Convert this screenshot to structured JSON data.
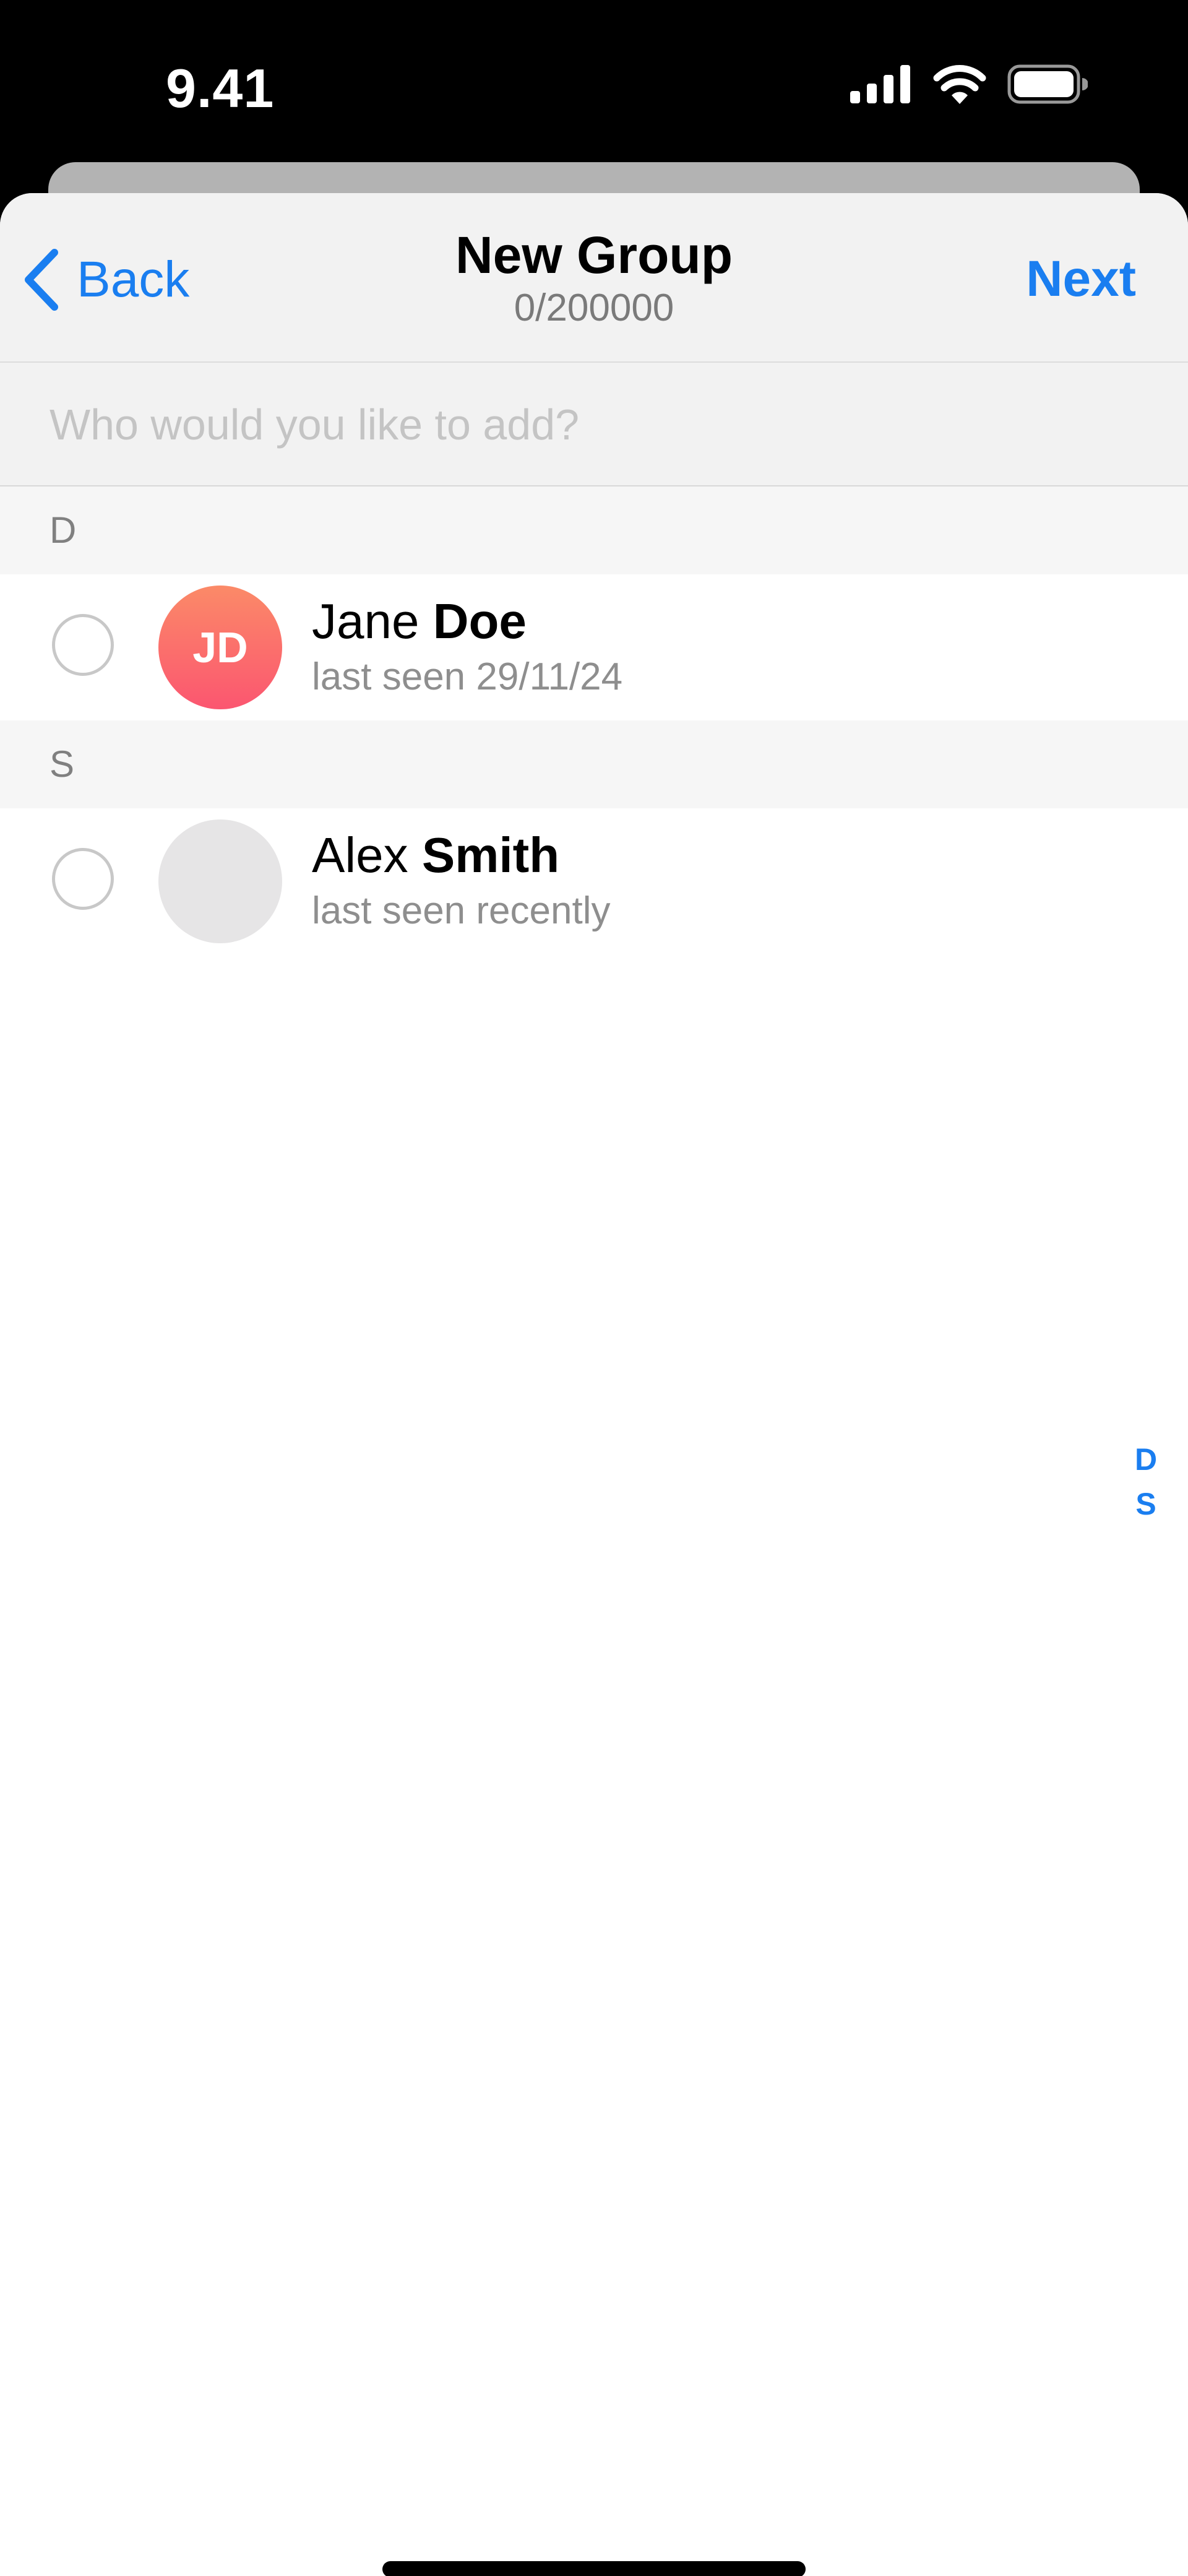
{
  "status_bar": {
    "time": "9.41",
    "icons": [
      "cellular-signal-icon",
      "wifi-icon",
      "battery-icon"
    ]
  },
  "nav": {
    "back_label": "Back",
    "title": "New Group",
    "subtitle": "0/200000",
    "next_label": "Next"
  },
  "search": {
    "placeholder": "Who would you like to add?",
    "value": ""
  },
  "sections": [
    {
      "letter": "D",
      "contacts": [
        {
          "first_name": "Jane",
          "last_name": "Doe",
          "status": "last seen 29/11/24",
          "initials": "JD",
          "selected": false
        }
      ]
    },
    {
      "letter": "S",
      "contacts": [
        {
          "first_name": "Alex",
          "last_name": "Smith",
          "status": "last seen recently",
          "initials": "",
          "selected": false
        }
      ]
    }
  ],
  "index_letters": [
    "D",
    "S"
  ],
  "colors": {
    "accent": "#1a7ef0",
    "avatar_jd_top": "#fb8a68",
    "avatar_jd_bottom": "#fb5670",
    "avatar_empty": "#e6e5e6"
  }
}
